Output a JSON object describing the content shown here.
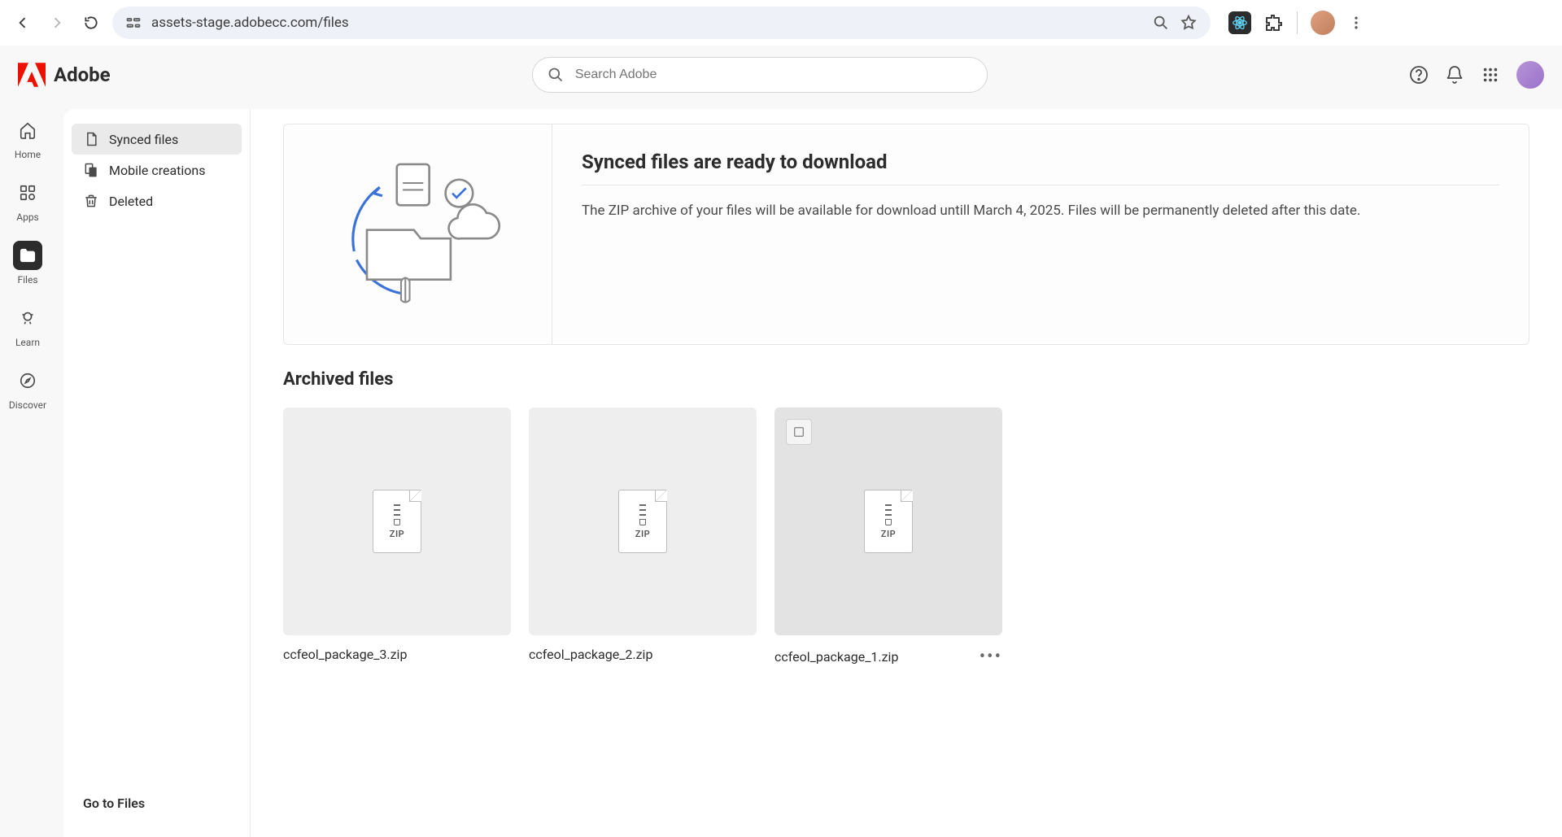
{
  "browser": {
    "url": "assets-stage.adobecc.com/files"
  },
  "header": {
    "brand": "Adobe",
    "search_placeholder": "Search Adobe"
  },
  "rail": {
    "items": [
      {
        "label": "Home"
      },
      {
        "label": "Apps"
      },
      {
        "label": "Files"
      },
      {
        "label": "Learn"
      },
      {
        "label": "Discover"
      }
    ]
  },
  "side": {
    "items": [
      {
        "label": "Synced files"
      },
      {
        "label": "Mobile creations"
      },
      {
        "label": "Deleted"
      }
    ],
    "footer": "Go to Files"
  },
  "banner": {
    "title": "Synced files are ready to download",
    "desc": "The ZIP archive of your files will be available for download untill March 4, 2025. Files will be permanently deleted after this date."
  },
  "section": {
    "title": "Archived files"
  },
  "files": [
    {
      "name": "ccfeol_package_3.zip",
      "ext": "ZIP"
    },
    {
      "name": "ccfeol_package_2.zip",
      "ext": "ZIP"
    },
    {
      "name": "ccfeol_package_1.zip",
      "ext": "ZIP"
    }
  ]
}
